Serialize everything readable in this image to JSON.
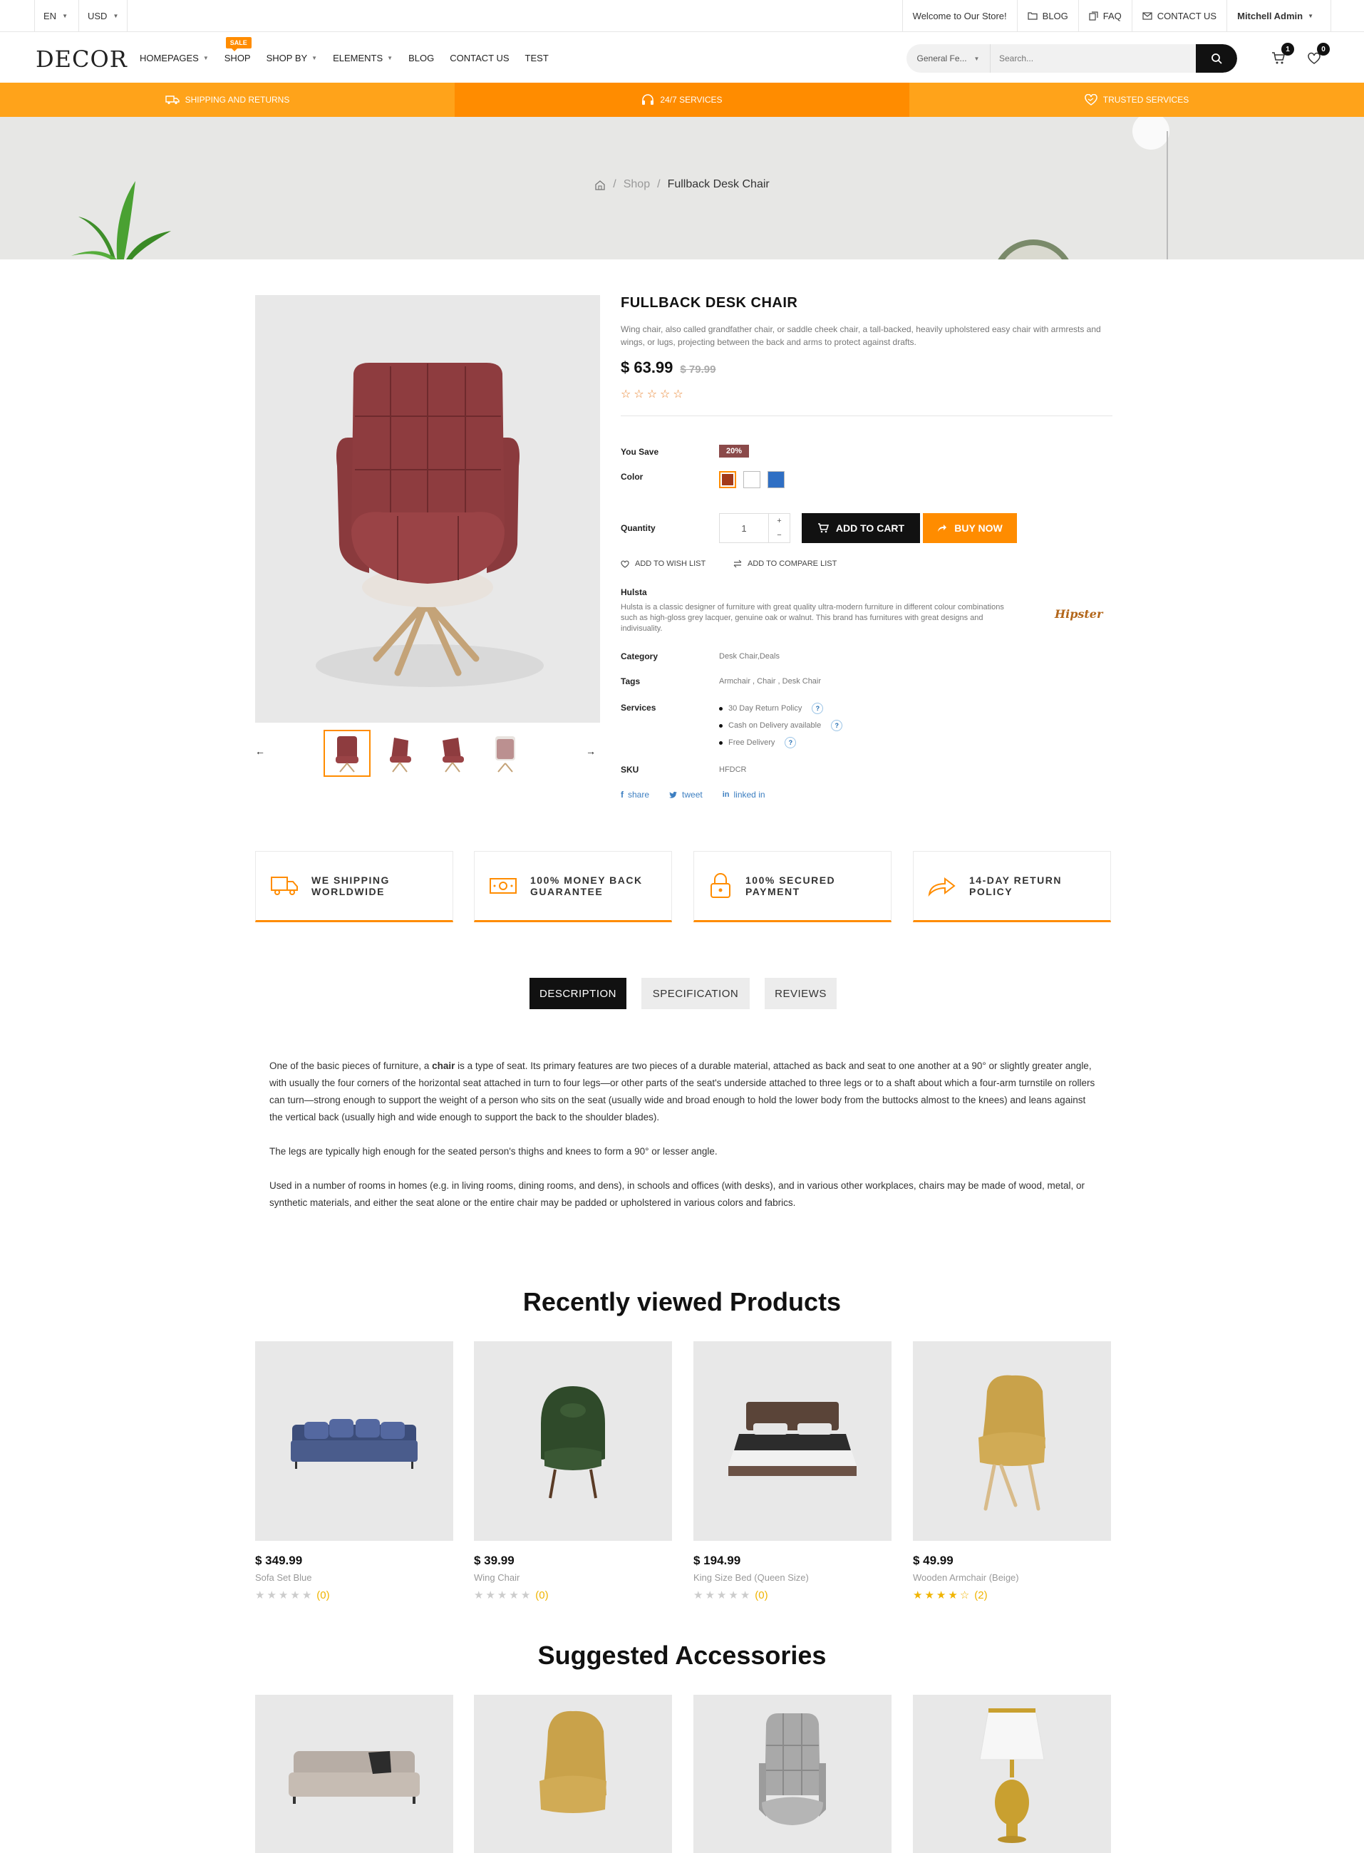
{
  "topbar": {
    "language": "EN",
    "currency": "USD",
    "welcome": "Welcome to Our Store!",
    "blog": "BLOG",
    "faq": "FAQ",
    "contact": "CONTACT US",
    "user": "Mitchell Admin"
  },
  "header": {
    "logo": "DECOR",
    "nav": [
      {
        "label": "HOMEPAGES",
        "dropdown": true
      },
      {
        "label": "SHOP",
        "badge": "SALE"
      },
      {
        "label": "SHOP BY",
        "dropdown": true
      },
      {
        "label": "ELEMENTS",
        "dropdown": true
      },
      {
        "label": "BLOG"
      },
      {
        "label": "CONTACT US"
      },
      {
        "label": "TEST"
      }
    ],
    "search_category": "General Fe...",
    "search_placeholder": "Search...",
    "cart_count": "1",
    "wishlist_count": "0"
  },
  "strip": {
    "shipping": "SHIPPING AND RETURNS",
    "services": "24/7 SERVICES",
    "trusted": "TRUSTED SERVICES"
  },
  "breadcrumb": {
    "shop": "Shop",
    "current": "Fullback Desk Chair"
  },
  "product": {
    "title": "FULLBACK DESK CHAIR",
    "description": "Wing chair, also called grandfather chair, or saddle cheek chair, a tall-backed, heavily upholstered easy chair with armrests and wings, or lugs, projecting between the back and arms to protect against drafts.",
    "price": "$ 63.99",
    "old_price": "$ 79.99",
    "rating": 0,
    "you_save_label": "You Save",
    "you_save_value": "20%",
    "color_label": "Color",
    "colors": [
      "#a33a1a",
      "#ffffff",
      "#2f6fc4"
    ],
    "quantity_label": "Quantity",
    "quantity": "1",
    "add_to_cart": "ADD TO CART",
    "buy_now": "BUY NOW",
    "wishlist": "ADD TO WISH LIST",
    "compare": "ADD TO COMPARE LIST",
    "brand_name": "Hulsta",
    "brand_desc": "Hulsta is a classic designer of furniture with great quality ultra-modern furniture in different colour combinations such as high-gloss grey lacquer, genuine oak or walnut. This brand has furnitures with great designs and indivisuality.",
    "brand_logo_text": "Hipster",
    "category_label": "Category",
    "category": "Desk Chair,Deals",
    "tags_label": "Tags",
    "tags": "Armchair , Chair , Desk Chair",
    "services_label": "Services",
    "services": [
      "30 Day Return Policy",
      "Cash on Delivery available",
      "Free Delivery"
    ],
    "sku_label": "SKU",
    "sku": "HFDCR",
    "share": {
      "facebook": "share",
      "twitter": "tweet",
      "linkedin": "linked in"
    }
  },
  "features": [
    {
      "line1": "WE SHIPPING",
      "line2": "WORLDWIDE",
      "icon": "truck-icon"
    },
    {
      "line1": "100% MONEY BACK",
      "line2": "GUARANTEE",
      "icon": "money-icon"
    },
    {
      "line1": "100% SECURED",
      "line2": "PAYMENT",
      "icon": "lock-icon"
    },
    {
      "line1": "14-DAY RETURN",
      "line2": "POLICY",
      "icon": "return-arrow-icon"
    }
  ],
  "tabs": [
    "DESCRIPTION",
    "SPECIFICATION",
    "REVIEWS"
  ],
  "description": {
    "p1_before": "One of the basic pieces of furniture, a ",
    "p1_bold": "chair",
    "p1_after": " is a type of seat. Its primary features are two pieces of a durable material, attached as back and seat to one another at a 90° or slightly greater angle, with usually the four corners of the horizontal seat attached in turn to four legs—or other parts of the seat's underside attached to three legs or to a shaft about which a four-arm turnstile on rollers can turn—strong enough to support the weight of a person who sits on the seat (usually wide and broad enough to hold the lower body from the buttocks almost to the knees) and leans against the vertical back (usually high and wide enough to support the back to the shoulder blades).",
    "p2": "The legs are typically high enough for the seated person's thighs and knees to form a 90° or lesser angle.",
    "p3": "Used in a number of rooms in homes (e.g. in living rooms, dining rooms, and dens), in schools and offices (with desks), and in various other workplaces, chairs may be made of wood, metal, or synthetic materials, and either the seat alone or the entire chair may be padded or upholstered in various colors and fabrics."
  },
  "recent": {
    "title": "Recently viewed Products",
    "items": [
      {
        "price": "$ 349.99",
        "name": "Sofa Set Blue",
        "rating": 0,
        "count": "(0)"
      },
      {
        "price": "$ 39.99",
        "name": "Wing Chair",
        "rating": 0,
        "count": "(0)"
      },
      {
        "price": "$ 194.99",
        "name": "King Size Bed (Queen Size)",
        "rating": 0,
        "count": "(0)"
      },
      {
        "price": "$ 49.99",
        "name": "Wooden Armchair (Beige)",
        "rating": 4.5,
        "count": "(2)"
      }
    ]
  },
  "accessories": {
    "title": "Suggested Accessories"
  }
}
